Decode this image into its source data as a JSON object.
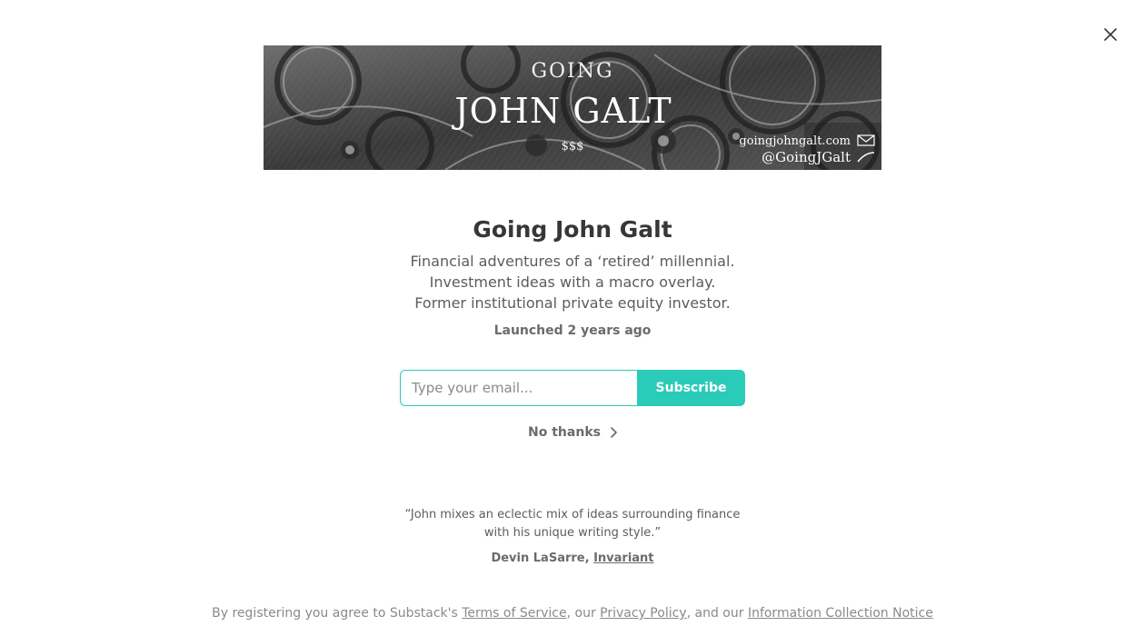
{
  "close_icon": "close-icon",
  "banner": {
    "line1": "GOING",
    "line2": "JOHN GALT",
    "line3": "$$$",
    "website": "goingjohngalt.com",
    "handle": "@GoingJGalt"
  },
  "publication": {
    "title": "Going John Galt",
    "description": [
      "Financial adventures of a ‘retired’ millennial.",
      "Investment ideas with a macro overlay.",
      "Former institutional private equity investor."
    ],
    "launched": "Launched 2 years ago"
  },
  "subscribe": {
    "email_placeholder": "Type your email...",
    "email_value": "",
    "button_label": "Subscribe",
    "accent_color": "#2bcbb9"
  },
  "no_thanks": {
    "label": "No thanks",
    "icon": "chevron-right-icon"
  },
  "testimonial": {
    "quote_line1": "“John mixes an eclectic mix of ideas surrounding finance",
    "quote_line2": "with his unique writing style.”",
    "author": "Devin LaSarre, ",
    "publication": "Invariant"
  },
  "legal": {
    "prefix": "By registering you agree to Substack's ",
    "terms": "Terms of Service",
    "sep1": ", our ",
    "privacy": "Privacy Policy",
    "sep2": ", and our ",
    "notice": "Information Collection Notice"
  }
}
